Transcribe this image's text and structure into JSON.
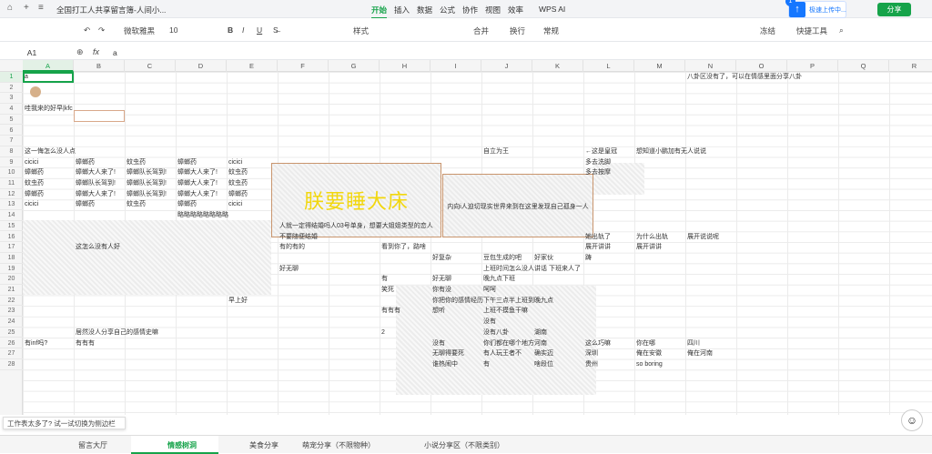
{
  "titlebar": {
    "doc_title": "全国打工人共享留言簿-人间小...",
    "menus": [
      "开始",
      "插入",
      "数据",
      "公式",
      "协作",
      "视图",
      "效率",
      "WPS AI"
    ],
    "upload": "极速上传中...",
    "upload_badge": "1",
    "share": "分享"
  },
  "toolbar": {
    "font": "微软雅黑",
    "size": "10",
    "style": "样式",
    "merge": "合并",
    "wrap": "换行",
    "format": "常规",
    "freeze": "冻结",
    "tools": "快捷工具"
  },
  "formula": {
    "name_box": "A1",
    "fx": "fx",
    "value": "a"
  },
  "columns": [
    "A",
    "B",
    "C",
    "D",
    "E",
    "F",
    "G",
    "H",
    "I",
    "J",
    "K",
    "L",
    "M",
    "N",
    "O",
    "P",
    "Q",
    "R"
  ],
  "rows": [
    "1",
    "2",
    "3",
    "4",
    "5",
    "6",
    "7",
    "8",
    "9",
    "10",
    "11",
    "12",
    "13",
    "14",
    "15",
    "16",
    "17",
    "18",
    "19",
    "20",
    "21",
    "22",
    "23",
    "24",
    "25",
    "26",
    "27",
    "28"
  ],
  "cells": {
    "a1": "a",
    "n1": "八卦区没有了，可以在情感里面分享八卦",
    "a4": "哇我来的好早|kfc",
    "a8": "这一悔怎么没人点",
    "j8": "自立为王",
    "l8": "←这是皇冠",
    "m8": "想知道小鹏加有无人说说",
    "a9": "cicici",
    "b9": "蟑螂药",
    "c9": "蚊虫药",
    "d9": "蟑螂药",
    "e9": "cicici",
    "l9": "多去洗脚",
    "a10": "蟑螂药",
    "b10": "蟑螂大人来了!",
    "c10": "蟑螂队长驾到!",
    "d10": "蟑螂大人来了!",
    "e10": "蚊虫药",
    "l10": "多去按摩",
    "a11": "蚊虫药",
    "b11": "蟑螂队长驾到!",
    "c11": "蟑螂队长驾到!",
    "d11": "蟑螂大人来了!",
    "e11": "蚊虫药",
    "a12": "蟑螂药",
    "b12": "蟑螂大人来了!",
    "c12": "蟑螂队长驾到!",
    "d12": "蟑螂大人来了!",
    "e12": "蟑螂药",
    "a13": "cicici",
    "b13": "蟑螂药",
    "c13": "蚊虫药",
    "d13": "蟑螂药",
    "e13": "cicici",
    "d14": "略略略略略略略略",
    "f15": "人就一定得结婚吗人03号单身，想要大姐姐类型的恋人",
    "f16": "不要随便结婚",
    "l16": "她出轨了",
    "m16": "为什么出轨",
    "n16": "展开说说呢",
    "b17": "这怎么没有人好",
    "f17": "有的有的",
    "h17": "看到你了，路啥",
    "l17": "展开讲讲",
    "m17": "展开讲讲",
    "i18": "好复杂",
    "j18": "豆包生成的吧",
    "k18": "好家伙",
    "l18": "踌",
    "f19": "好无聊",
    "j19": "上班时间怎么没人讲话 下班来人了",
    "h20": "有",
    "i20": "好无聊",
    "j20": "晚九点下班",
    "h21": "笑死",
    "i21": "你有没",
    "j21": "呵呵",
    "e22": "早上好",
    "i22": "你把你的感情经历下午三点半上班到晚九点",
    "h23": "有有有",
    "i23": "想听",
    "j23": "上班不摸鱼干嘛",
    "j24": "没有",
    "b25": "居然没人分享自己的感情史嘛",
    "h25": "2",
    "j25": "没有八卦",
    "k25": "湖南",
    "a26": "有inf吗?",
    "b26": "有有有",
    "i26": "没有",
    "j26": "你们都在哪个地方",
    "k26": "河南",
    "l26": "这么巧嘛",
    "m26": "你在哪",
    "n26": "四川",
    "i27": "无聊得要死",
    "j27": "有人玩王者不",
    "k27": "确实迈",
    "l27": "深圳",
    "m27": "俺在安徽",
    "n27": "俺在河南",
    "i28": "谁热闹中",
    "j28": "有",
    "k28": "啥段位",
    "l28": "贵州",
    "m28": "so boring"
  },
  "merged": {
    "big": "朕要睡大床",
    "mid": "内向i人迫切现实世界来到在这里发现自己孤身一人"
  },
  "tip": "工作表太多了? 试一试切换为侧边栏",
  "sheets": [
    "留言大厅",
    "情感树洞",
    "美食分享",
    "萌宠分享（不限物种）",
    "小说分享区（不限类别）"
  ]
}
